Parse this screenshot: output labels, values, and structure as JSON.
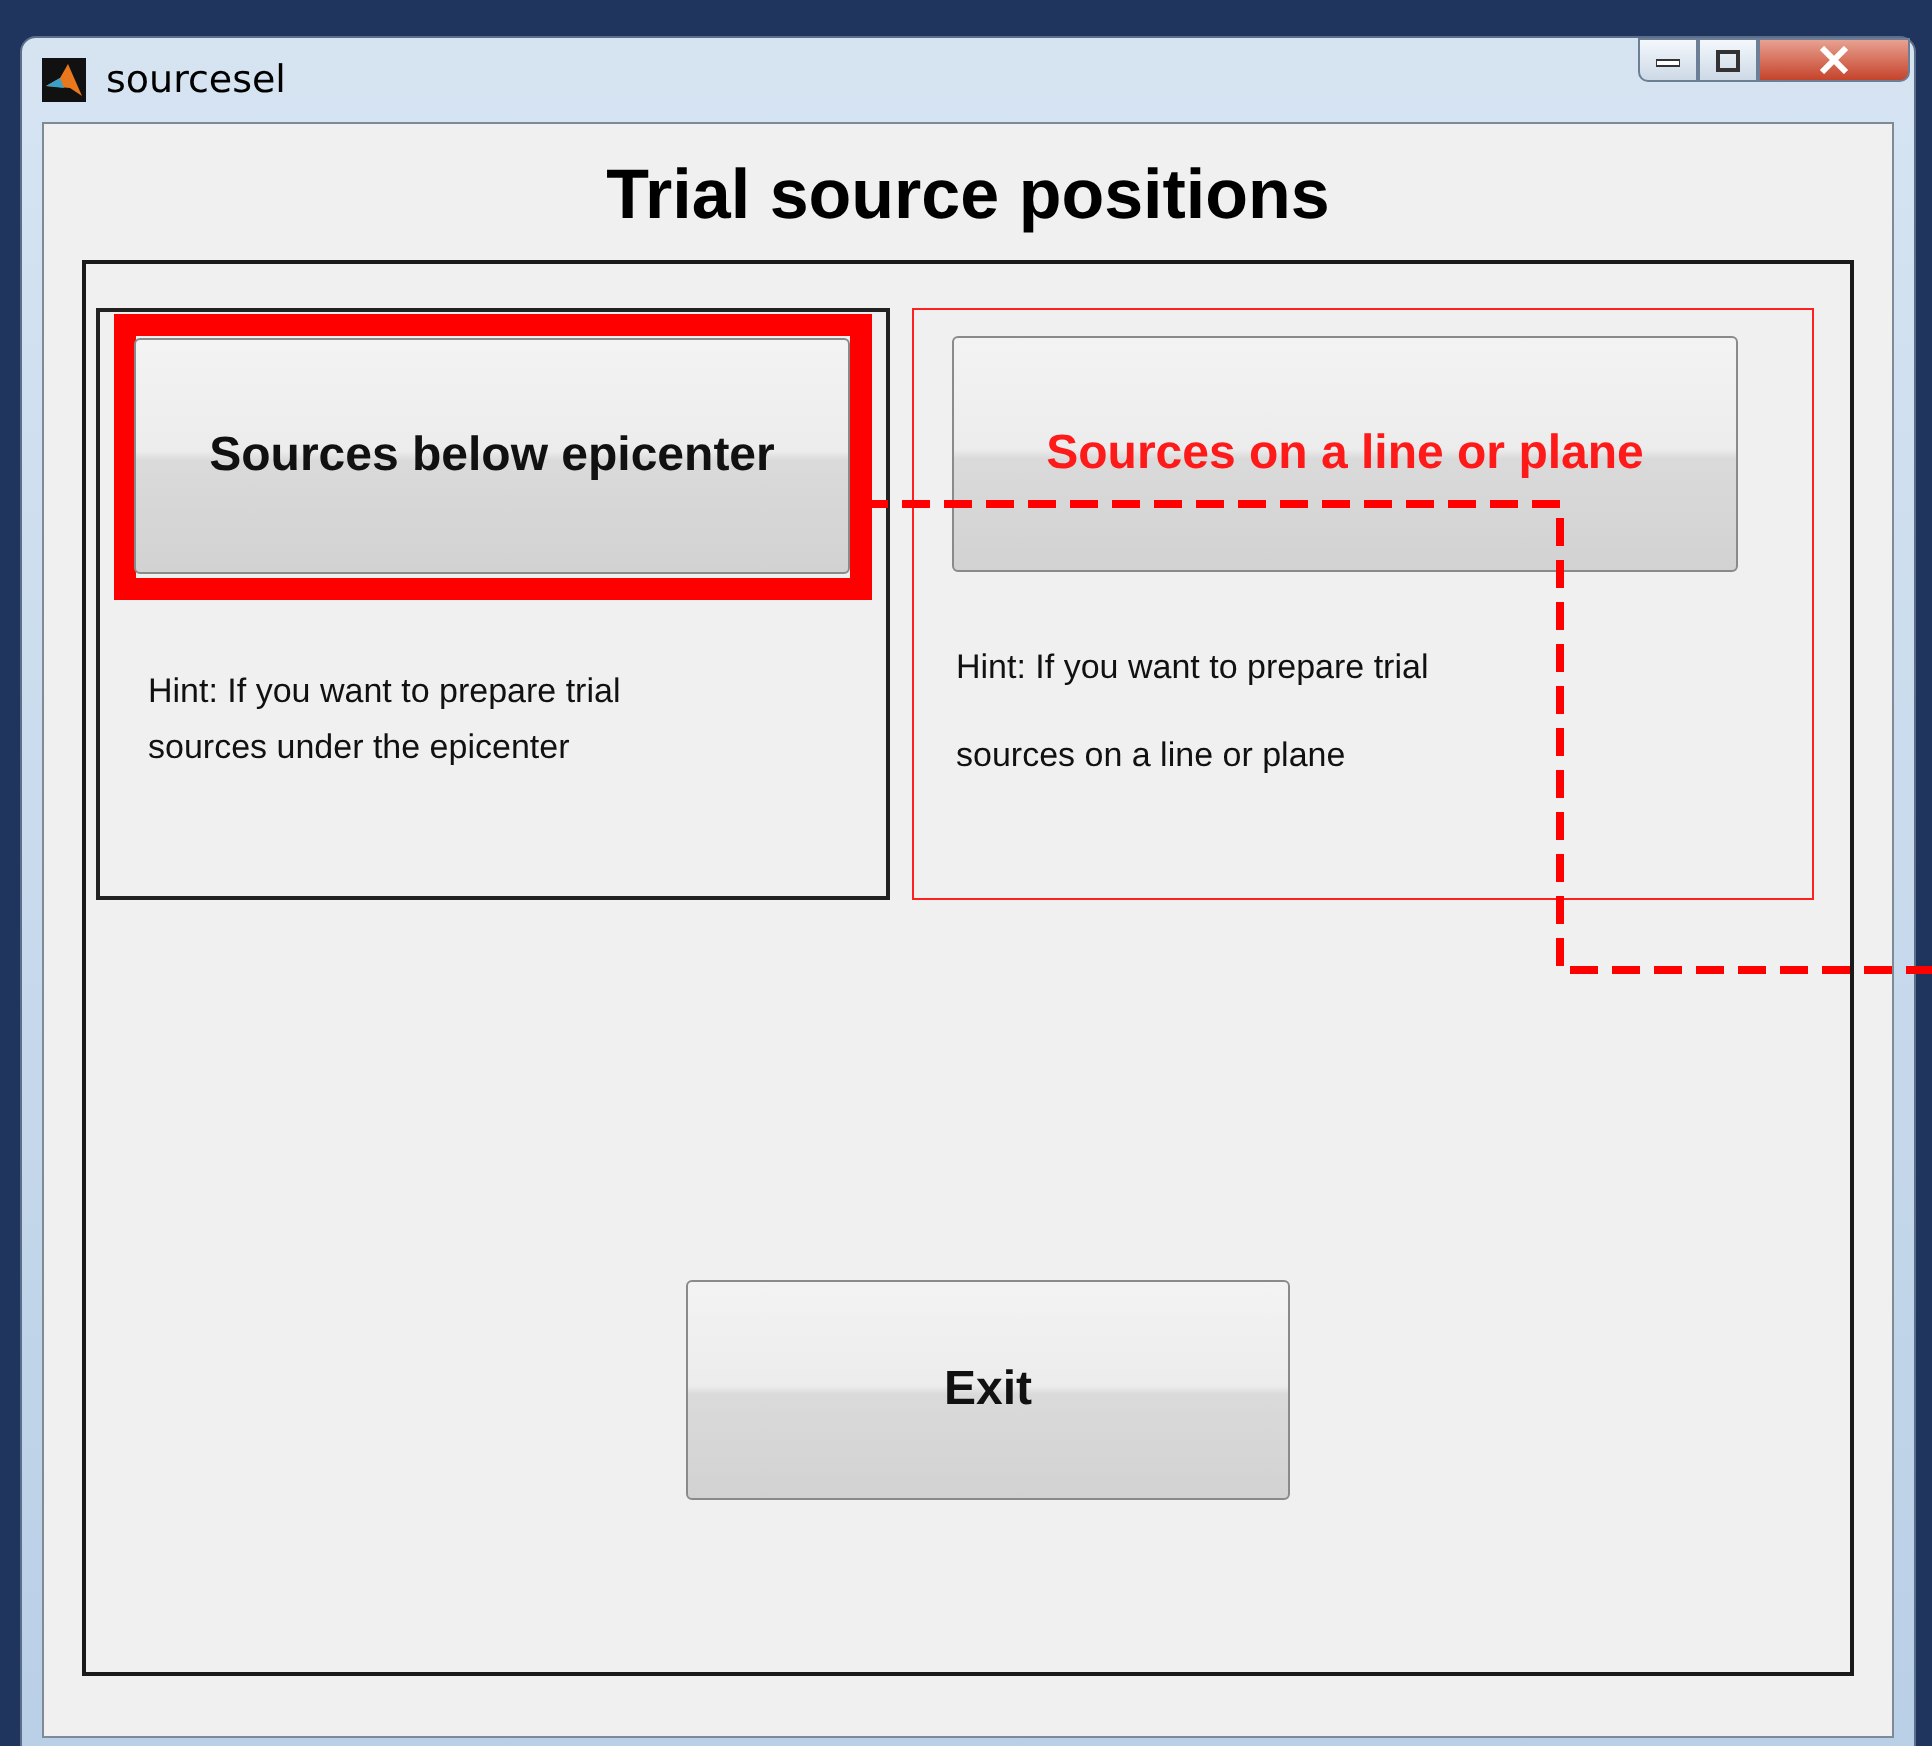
{
  "window": {
    "title": "sourcesel"
  },
  "heading": "Trial source positions",
  "panels": [
    {
      "button": "Sources below epicenter",
      "hint": "Hint: If you want to prepare trial sources under the epicenter",
      "button_highlighted": true,
      "panel_highlighted": false
    },
    {
      "button": "Sources on a line or plane",
      "hint": "Hint: If you want to prepare trial sources on a line or plane",
      "button_highlighted": false,
      "panel_highlighted": true
    }
  ],
  "exit_button": "Exit"
}
